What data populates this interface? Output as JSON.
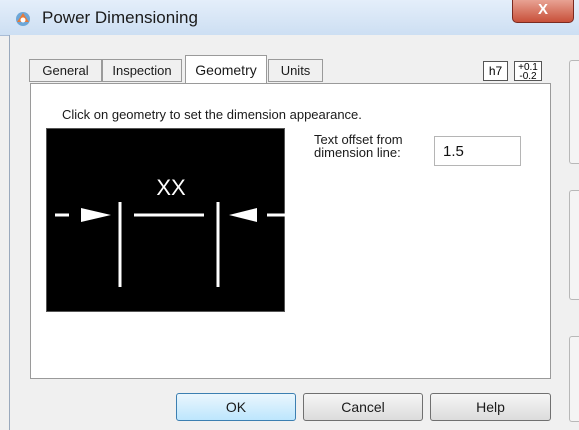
{
  "window": {
    "title": "Power Dimensioning",
    "close_glyph": "X",
    "app_icon": "power-dimensioning-icon"
  },
  "tabs": [
    {
      "label": "General",
      "active": false
    },
    {
      "label": "Inspection",
      "active": false
    },
    {
      "label": "Geometry",
      "active": true
    },
    {
      "label": "Units",
      "active": false
    }
  ],
  "tolerance_buttons": {
    "fit_label": "h7",
    "plus_value": "+0.1",
    "minus_value": "-0.2"
  },
  "geometry_panel": {
    "instruction": "Click on geometry to set the dimension appearance.",
    "preview_label": "XX",
    "text_offset_label_line1": "Text offset from",
    "text_offset_label_line2": "dimension line:",
    "text_offset_value": "1.5"
  },
  "buttons": {
    "ok": "OK",
    "cancel": "Cancel",
    "help": "Help"
  },
  "colors": {
    "preview_background": "#000000",
    "preview_lines": "#ffffff",
    "close_button": "#c8503a",
    "default_button": "#bde6fd"
  }
}
